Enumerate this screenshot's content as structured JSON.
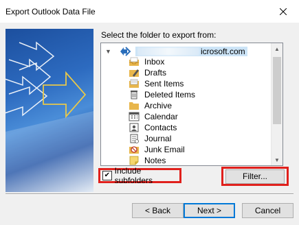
{
  "window": {
    "title": "Export Outlook Data File"
  },
  "prompt": "Select the folder to export from:",
  "tree": {
    "root_suffix": "icrosoft.com",
    "folders": [
      {
        "label": "Inbox",
        "icon": "inbox-icon"
      },
      {
        "label": "Drafts",
        "icon": "drafts-icon"
      },
      {
        "label": "Sent Items",
        "icon": "sent-items-icon"
      },
      {
        "label": "Deleted Items",
        "icon": "deleted-items-icon"
      },
      {
        "label": "Archive",
        "icon": "archive-folder-icon"
      },
      {
        "label": "Calendar",
        "icon": "calendar-icon"
      },
      {
        "label": "Contacts",
        "icon": "contacts-icon"
      },
      {
        "label": "Journal",
        "icon": "journal-icon"
      },
      {
        "label": "Junk Email",
        "icon": "junk-email-icon"
      },
      {
        "label": "Notes",
        "icon": "notes-icon"
      }
    ]
  },
  "include_subfolders": {
    "label": "Include subfolders",
    "checked": true
  },
  "buttons": {
    "filter": "Filter...",
    "back": "< Back",
    "next": "Next >",
    "cancel": "Cancel"
  },
  "colors": {
    "highlight": "#e0201c",
    "selection": "#cce4f7",
    "accent": "#0078d7"
  }
}
